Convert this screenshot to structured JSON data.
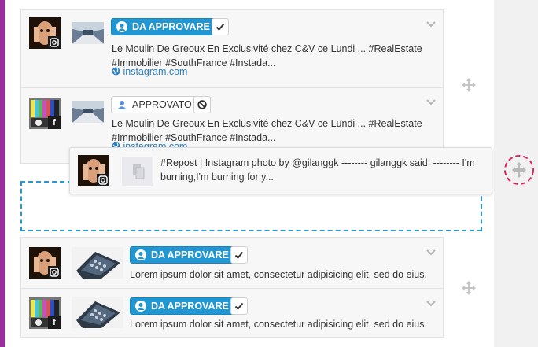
{
  "colors": {
    "accent": "#2096d3",
    "left_bar": "#9b2c9e",
    "link": "#2a7fc4",
    "drag_target": "#e0245e",
    "drop_zone_border": "#2c96c9"
  },
  "posts": [
    {
      "network_icon": "instagram-icon",
      "status_label": "DA APPROVARE",
      "status_style": "pending",
      "action_icon": "check-icon",
      "text": "Le Moulin De Greoux En Exclusivité chez C&V ce Lundi ... #RealEstate #Immobilier #SouthFrance #Instada...",
      "link": "instagram.com"
    },
    {
      "network_icon": "facebook-icon",
      "status_label": "APPROVATO",
      "status_style": "approved",
      "action_icon": "ban-icon",
      "text": "Le Moulin De Greoux En Exclusivité chez C&V ce Lundi ... #RealEstate #Immobilier #SouthFrance #Instada...",
      "link": "instagram.com"
    },
    {
      "network_icon": "instagram-icon",
      "status_label": "DA APPROVARE",
      "status_style": "pending",
      "action_icon": "check-icon",
      "text": "Lorem ipsum dolor sit amet, consectetur adipisicing elit, sed do eius."
    },
    {
      "network_icon": "facebook-icon",
      "status_label": "DA APPROVARE",
      "status_style": "pending",
      "action_icon": "check-icon",
      "text": "Lorem ipsum dolor sit amet, consectetur adipisicing elit, sed do eius."
    }
  ],
  "dragged_post": {
    "network_icon": "instagram-icon",
    "text": "#Repost | Instagram photo by @gilanggk -------- gilanggk said: -------- I'm burning,I'm burning for y..."
  }
}
